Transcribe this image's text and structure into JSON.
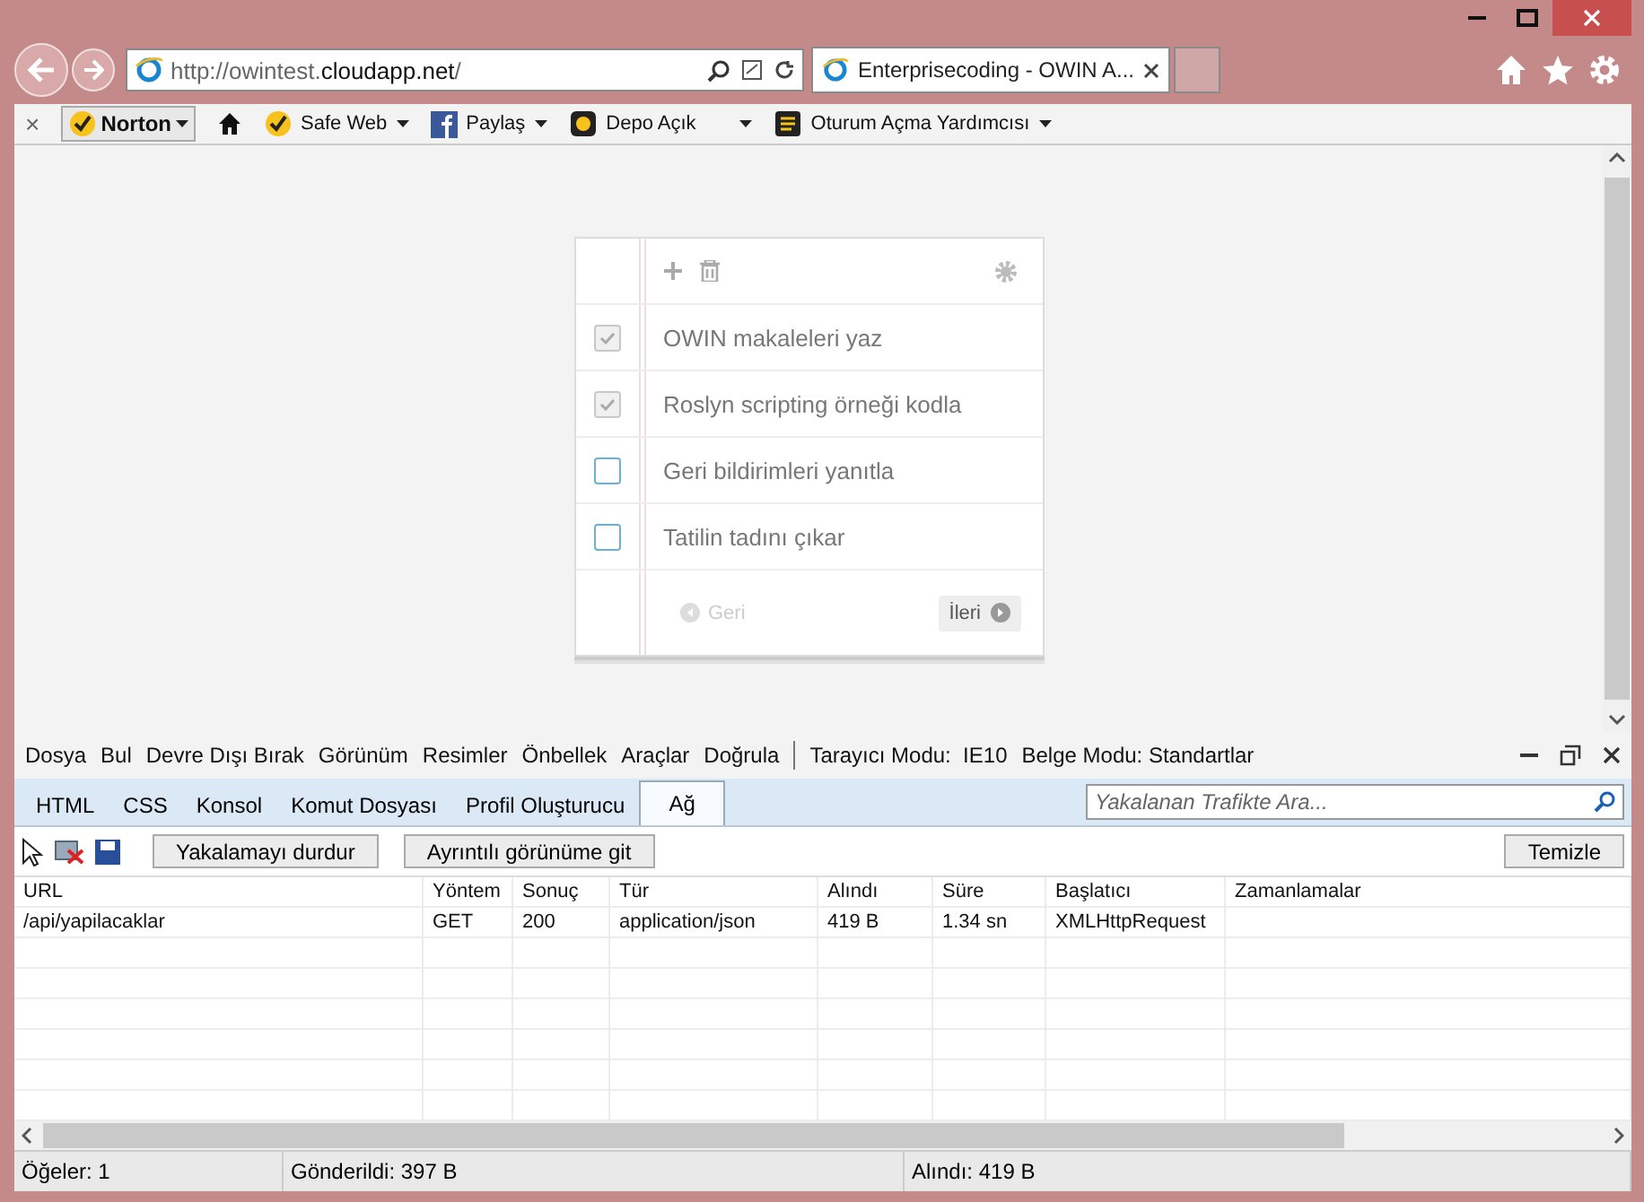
{
  "address_bar": {
    "prefix": "http://owintest.",
    "domain": "cloudapp.net",
    "suffix": "/"
  },
  "tabs": [
    {
      "label": "Enterprisecoding - OWIN A...",
      "selected": true
    }
  ],
  "toolbar": {
    "close": "×",
    "items": [
      {
        "kind": "norton",
        "label": "Norton"
      },
      {
        "kind": "home"
      },
      {
        "kind": "safeweb",
        "label": "Safe Web"
      },
      {
        "kind": "facebook",
        "label": "Paylaş"
      },
      {
        "kind": "vault",
        "label": "Depo Açık"
      },
      {
        "kind": "login",
        "label": "Oturum Açma Yardımcısı"
      }
    ]
  },
  "todo": {
    "items": [
      {
        "text": "OWIN makaleleri yaz",
        "checked": true
      },
      {
        "text": "Roslyn scripting örneği kodla",
        "checked": true
      },
      {
        "text": "Geri bildirimleri yanıtla",
        "checked": false
      },
      {
        "text": "Tatilin tadını çıkar",
        "checked": false
      }
    ],
    "prev": {
      "label": "Geri",
      "disabled": true
    },
    "next": {
      "label": "İleri",
      "disabled": false
    }
  },
  "devtools": {
    "menu": [
      "Dosya",
      "Bul",
      "Devre Dışı Bırak",
      "Görünüm",
      "Resimler",
      "Önbellek",
      "Araçlar",
      "Doğrula"
    ],
    "modes": [
      "Tarayıcı Modu:  IE10",
      "Belge Modu: Standartlar"
    ],
    "tabs": [
      {
        "label": "HTML",
        "selected": false
      },
      {
        "label": "CSS",
        "selected": false
      },
      {
        "label": "Konsol",
        "selected": false
      },
      {
        "label": "Komut Dosyası",
        "selected": false
      },
      {
        "label": "Profil Oluşturucu",
        "selected": false
      },
      {
        "label": "Ağ",
        "selected": true
      }
    ],
    "search": {
      "placeholder": "Yakalanan Trafikte Ara..."
    },
    "buttons": [
      "Yakalamayı durdur",
      "Ayrıntılı görünüme git"
    ],
    "clear_button": "Temizle",
    "table": {
      "columns": [
        "URL",
        "Yöntem",
        "Sonuç",
        "Tür",
        "Alındı",
        "Süre",
        "Başlatıcı",
        "Zamanlamalar"
      ],
      "rows": [
        [
          "/api/yapilacaklar",
          "GET",
          "200",
          "application/json",
          "419 B",
          "1.34 sn",
          "XMLHttpRequest",
          ""
        ]
      ]
    },
    "status_bar": [
      "Öğeler: 1",
      "Gönderildi: 397 B",
      "Alındı: 419 B"
    ]
  }
}
